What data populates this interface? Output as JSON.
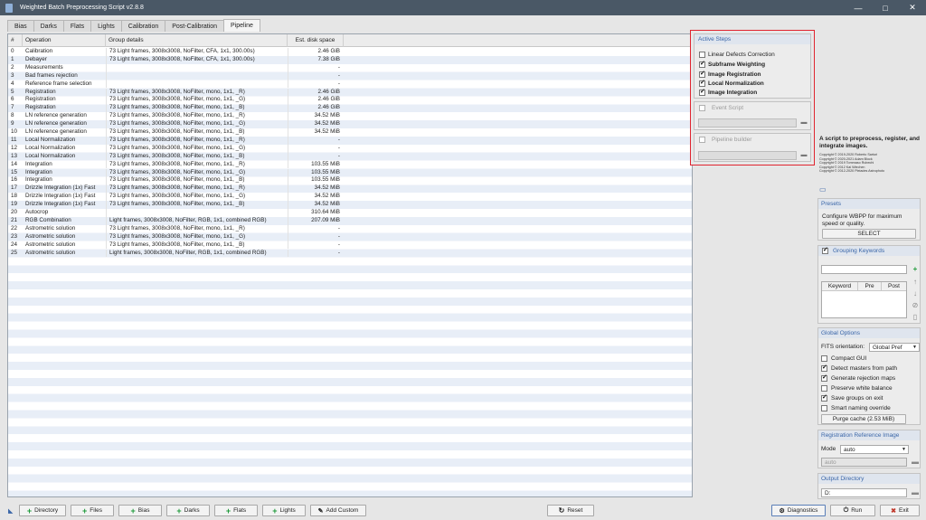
{
  "window": {
    "title": "Weighted Batch Preprocessing Script v2.8.8",
    "minimize_glyph": "—",
    "maximize_glyph": "□",
    "close_glyph": "✕"
  },
  "tabs": [
    "Bias",
    "Darks",
    "Flats",
    "Lights",
    "Calibration",
    "Post-Calibration",
    "Pipeline"
  ],
  "table": {
    "headers": {
      "num": "#",
      "operation": "Operation",
      "group_details": "Group details",
      "disk_space": "Est. disk space"
    },
    "rows": [
      {
        "num": "0",
        "operation": "Calibration",
        "group": "73 Light frames, 3008x3008, NoFilter, CFA, 1x1, 300.00s)",
        "size": "2.46 GiB"
      },
      {
        "num": "1",
        "operation": "Debayer",
        "group": "73 Light frames, 3008x3008, NoFilter, CFA, 1x1, 300.00s)",
        "size": "7.38 GiB"
      },
      {
        "num": "2",
        "operation": "Measurements",
        "group": "",
        "size": "-"
      },
      {
        "num": "3",
        "operation": "Bad frames rejection",
        "group": "",
        "size": "-"
      },
      {
        "num": "4",
        "operation": "Reference frame selection",
        "group": "",
        "size": "-"
      },
      {
        "num": "5",
        "operation": "Registration",
        "group": "73 Light frames, 3008x3008, NoFilter, mono, 1x1, _R)",
        "size": "2.46 GiB"
      },
      {
        "num": "6",
        "operation": "Registration",
        "group": "73 Light frames, 3008x3008, NoFilter, mono, 1x1, _G)",
        "size": "2.46 GiB"
      },
      {
        "num": "7",
        "operation": "Registration",
        "group": "73 Light frames, 3008x3008, NoFilter, mono, 1x1, _B)",
        "size": "2.46 GiB"
      },
      {
        "num": "8",
        "operation": "LN reference generation",
        "group": "73 Light frames, 3008x3008, NoFilter, mono, 1x1, _R)",
        "size": "34.52 MiB"
      },
      {
        "num": "9",
        "operation": "LN reference generation",
        "group": "73 Light frames, 3008x3008, NoFilter, mono, 1x1, _G)",
        "size": "34.52 MiB"
      },
      {
        "num": "10",
        "operation": "LN reference generation",
        "group": "73 Light frames, 3008x3008, NoFilter, mono, 1x1, _B)",
        "size": "34.52 MiB"
      },
      {
        "num": "11",
        "operation": "Local Normalization",
        "group": "73 Light frames, 3008x3008, NoFilter, mono, 1x1, _R)",
        "size": "-"
      },
      {
        "num": "12",
        "operation": "Local Normalization",
        "group": "73 Light frames, 3008x3008, NoFilter, mono, 1x1, _G)",
        "size": "-"
      },
      {
        "num": "13",
        "operation": "Local Normalization",
        "group": "73 Light frames, 3008x3008, NoFilter, mono, 1x1, _B)",
        "size": "-"
      },
      {
        "num": "14",
        "operation": "Integration",
        "group": "73 Light frames, 3008x3008, NoFilter, mono, 1x1, _R)",
        "size": "103.55 MiB"
      },
      {
        "num": "15",
        "operation": "Integration",
        "group": "73 Light frames, 3008x3008, NoFilter, mono, 1x1, _G)",
        "size": "103.55 MiB"
      },
      {
        "num": "16",
        "operation": "Integration",
        "group": "73 Light frames, 3008x3008, NoFilter, mono, 1x1, _B)",
        "size": "103.55 MiB"
      },
      {
        "num": "17",
        "operation": "Drizzle Integration (1x) Fast",
        "group": "73 Light frames, 3008x3008, NoFilter, mono, 1x1, _R)",
        "size": "34.52 MiB"
      },
      {
        "num": "18",
        "operation": "Drizzle Integration (1x) Fast",
        "group": "73 Light frames, 3008x3008, NoFilter, mono, 1x1, _G)",
        "size": "34.52 MiB"
      },
      {
        "num": "19",
        "operation": "Drizzle Integration (1x) Fast",
        "group": "73 Light frames, 3008x3008, NoFilter, mono, 1x1, _B)",
        "size": "34.52 MiB"
      },
      {
        "num": "20",
        "operation": "Autocrop",
        "group": "",
        "size": "310.64 MiB"
      },
      {
        "num": "21",
        "operation": "RGB Combination",
        "group": "Light frames, 3008x3008, NoFilter, RGB, 1x1, combined RGB)",
        "size": "207.09 MiB"
      },
      {
        "num": "22",
        "operation": "Astrometric solution",
        "group": "73 Light frames, 3008x3008, NoFilter, mono, 1x1, _R)",
        "size": "-"
      },
      {
        "num": "23",
        "operation": "Astrometric solution",
        "group": "73 Light frames, 3008x3008, NoFilter, mono, 1x1, _G)",
        "size": "-"
      },
      {
        "num": "24",
        "operation": "Astrometric solution",
        "group": "73 Light frames, 3008x3008, NoFilter, mono, 1x1, _B)",
        "size": "-"
      },
      {
        "num": "25",
        "operation": "Astrometric solution",
        "group": "Light frames, 3008x3008, NoFilter, RGB, 1x1, combined RGB)",
        "size": "-"
      }
    ]
  },
  "active_steps": {
    "title": "Active Steps",
    "items": [
      {
        "label": "Linear Defects Correction",
        "checked": false
      },
      {
        "label": "Subframe Weighting",
        "checked": true
      },
      {
        "label": "Image Registration",
        "checked": true
      },
      {
        "label": "Local Normalization",
        "checked": true
      },
      {
        "label": "Image Integration",
        "checked": true
      }
    ],
    "event_script": "Event Script",
    "pipeline_builder": "Pipeline builder"
  },
  "description": "A script to preprocess, register, and integrate images.",
  "copyright": [
    "Copyright © 2019-2020 Roberto Sartori",
    "Copyright © 2020-2021 Adam Block",
    "Copyright © 2019 Tommaso Rubechi",
    "Copyright © 2012 Kai Wiechen",
    "Copyright © 2012-2020 Pleiades Astrophoto"
  ],
  "presets": {
    "title": "Presets",
    "text": "Configure WBPP for maximum speed or quality.",
    "button": "SELECT"
  },
  "grouping": {
    "title": "Grouping Keywords",
    "input_value": "",
    "headers": [
      "Keyword",
      "Pre",
      "Post"
    ]
  },
  "global_options": {
    "title": "Global Options",
    "fits_label": "FITS orientation:",
    "fits_value": "Global Pref",
    "options": [
      {
        "label": "Compact GUI",
        "checked": false
      },
      {
        "label": "Detect masters from path",
        "checked": true
      },
      {
        "label": "Generate rejection maps",
        "checked": true
      },
      {
        "label": "Preserve white balance",
        "checked": false
      },
      {
        "label": "Save groups on exit",
        "checked": true
      },
      {
        "label": "Smart naming override",
        "checked": false
      }
    ],
    "purge_button": "Purge cache (2.53 MiB)"
  },
  "registration_ref": {
    "title": "Registration Reference Image",
    "mode_label": "Mode",
    "mode_value": "auto",
    "field_value": "auto"
  },
  "output_dir": {
    "title": "Output Directory",
    "value": "D:"
  },
  "bottom_buttons": {
    "directory": "Directory",
    "files": "Files",
    "bias": "Bias",
    "darks": "Darks",
    "flats": "Flats",
    "lights": "Lights",
    "add_custom": "Add Custom",
    "reset": "Reset",
    "diagnostics": "Diagnostics",
    "run": "Run",
    "exit": "Exit"
  }
}
